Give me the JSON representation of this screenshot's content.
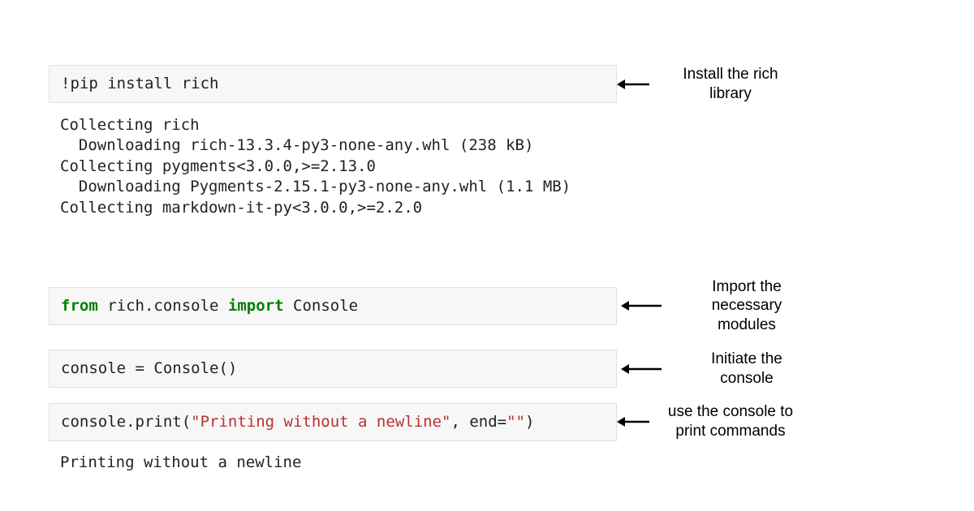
{
  "cells": {
    "install_cmd": "!pip install rich",
    "install_output": "Collecting rich\n  Downloading rich-13.3.4-py3-none-any.whl (238 kB)\nCollecting pygments<3.0.0,>=2.13.0\n  Downloading Pygments-2.15.1-py3-none-any.whl (1.1 MB)\nCollecting markdown-it-py<3.0.0,>=2.2.0",
    "import_line": {
      "kw_from": "from",
      "module": " rich.console ",
      "kw_import": "import",
      "name": " Console"
    },
    "init_line": "console = Console()",
    "print_line": {
      "prefix": "console.print(",
      "str1": "\"Printing without a newline\"",
      "mid": ", end=",
      "str2": "\"\"",
      "suffix": ")"
    },
    "print_output": "Printing without a newline"
  },
  "annotations": {
    "install": "Install the rich\nlibrary",
    "import": "Import the\nnecessary\nmodules",
    "init": "Initiate the\nconsole",
    "print": "use the console to\nprint commands"
  }
}
